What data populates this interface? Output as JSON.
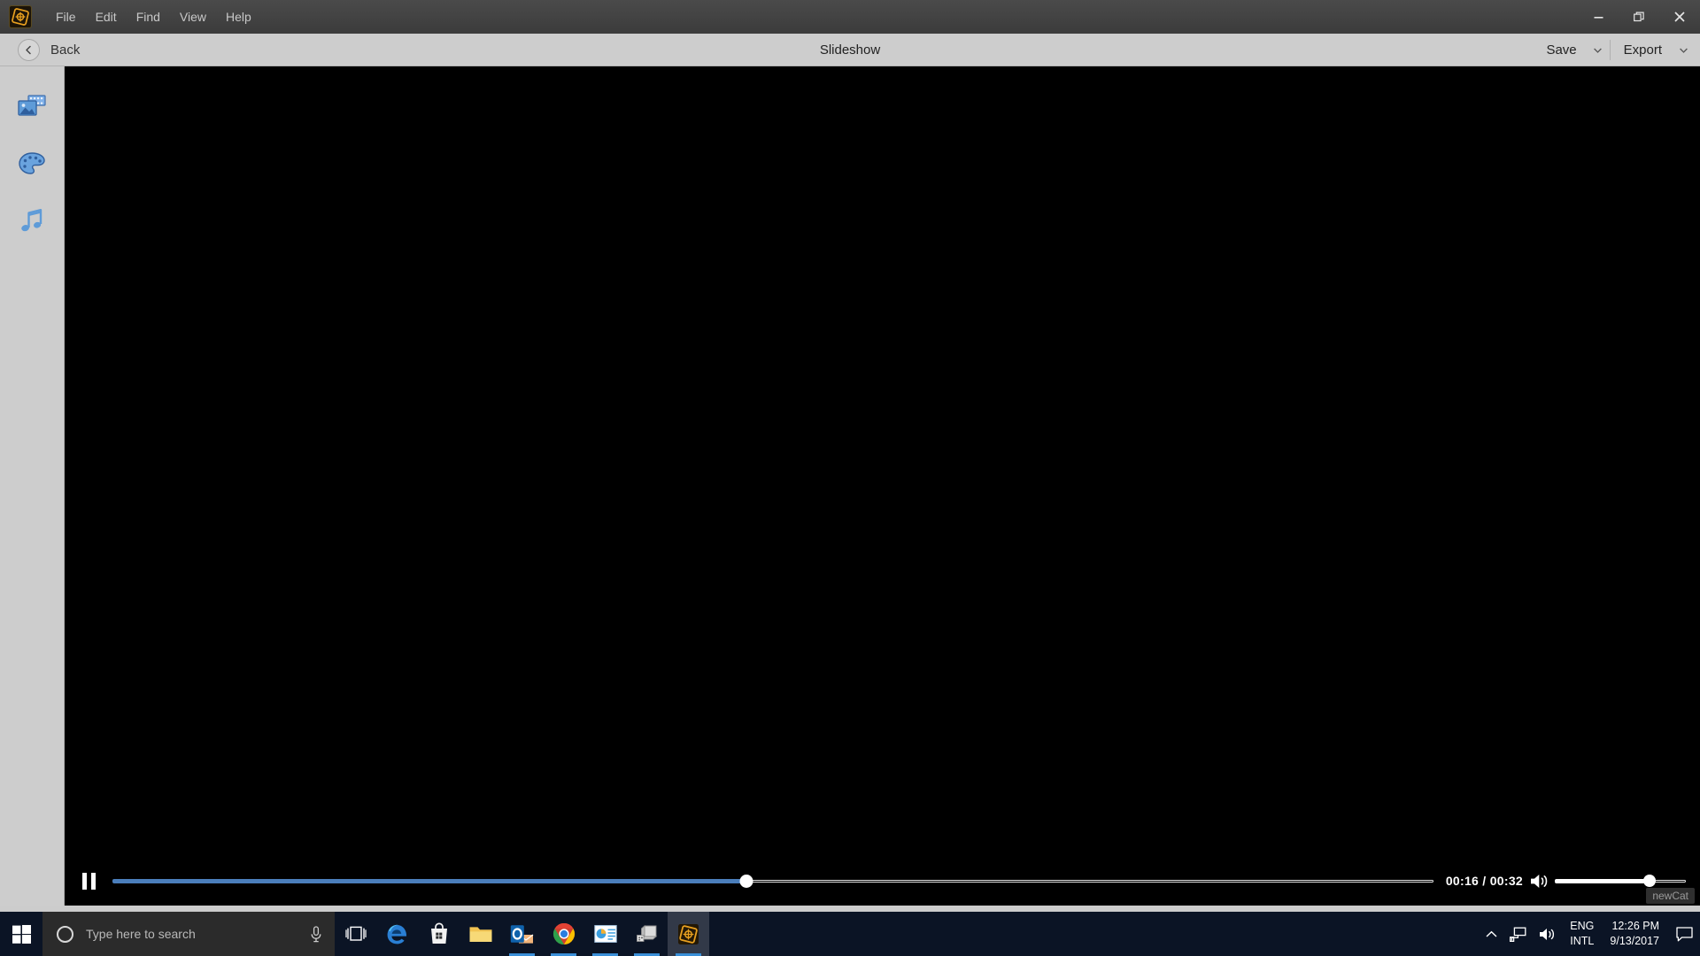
{
  "window": {
    "app_icon": "app-diamond-logo",
    "controls": {
      "minimize": "minimize-icon",
      "restore": "restore-icon",
      "close": "close-icon"
    }
  },
  "menubar": {
    "items": [
      {
        "label": "File"
      },
      {
        "label": "Edit"
      },
      {
        "label": "Find"
      },
      {
        "label": "View"
      },
      {
        "label": "Help"
      }
    ]
  },
  "toolbar": {
    "back_label": "Back",
    "back_icon": "chevron-left-icon",
    "title": "Slideshow",
    "save_label": "Save",
    "save_caret": "chevron-down-icon",
    "export_label": "Export",
    "export_caret": "chevron-down-icon"
  },
  "sidebar": {
    "items": [
      {
        "name": "media",
        "icon": "photo-film-icon"
      },
      {
        "name": "themes",
        "icon": "palette-icon"
      },
      {
        "name": "music",
        "icon": "music-note-icon"
      }
    ]
  },
  "preview": {
    "project_label": "newCat",
    "background": "#000000"
  },
  "player": {
    "state": "playing",
    "play_pause_icon": "pause-icon",
    "current_time": "00:16",
    "total_time": "00:32",
    "time_display": "00:16 / 00:32",
    "progress_percent": 48,
    "volume_icon": "speaker-on-icon",
    "volume_percent": 72,
    "accent_color": "#4a7ebb"
  },
  "taskbar": {
    "start_icon": "windows-start-icon",
    "search": {
      "cortana_icon": "cortana-circle-icon",
      "placeholder": "Type here to search",
      "mic_icon": "microphone-icon"
    },
    "apps": [
      {
        "name": "task-view",
        "icon": "task-view-icon",
        "running": false,
        "active": false
      },
      {
        "name": "microsoft-edge",
        "icon": "edge-icon",
        "running": false,
        "active": false
      },
      {
        "name": "microsoft-store",
        "icon": "store-bag-icon",
        "running": false,
        "active": false
      },
      {
        "name": "file-explorer",
        "icon": "folder-icon",
        "running": false,
        "active": false
      },
      {
        "name": "outlook",
        "icon": "outlook-envelope-icon",
        "running": true,
        "active": false
      },
      {
        "name": "google-chrome",
        "icon": "chrome-icon",
        "running": true,
        "active": false
      },
      {
        "name": "office-app",
        "icon": "office-chart-icon",
        "running": true,
        "active": false
      },
      {
        "name": "setup-installer",
        "icon": "installer-box-icon",
        "running": true,
        "active": false
      },
      {
        "name": "slideshow-app",
        "icon": "app-diamond-logo",
        "running": true,
        "active": true
      }
    ],
    "tray": {
      "show_hidden_icon": "chevron-up-icon",
      "network_icon": "network-icon",
      "volume_icon": "speaker-icon",
      "language_line1": "ENG",
      "language_line2": "INTL",
      "time": "12:26 PM",
      "date": "9/13/2017",
      "action_center_icon": "notification-icon"
    }
  }
}
